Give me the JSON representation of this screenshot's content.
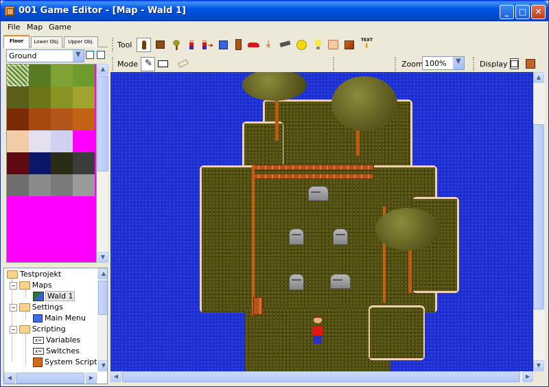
{
  "window": {
    "title": "001 Game Editor - [Map - Wald 1]"
  },
  "menu": [
    "File",
    "Map",
    "Game"
  ],
  "layer_tabs": [
    "Floor",
    "Lower Obj.",
    "Upper Obj."
  ],
  "tileset": {
    "selected": "Ground"
  },
  "tree": {
    "root": "Testprojekt",
    "items": [
      {
        "label": "Maps"
      },
      {
        "label": "Wald 1",
        "selected": true
      },
      {
        "label": "Settings"
      },
      {
        "label": "Main Menu"
      },
      {
        "label": "Scripting"
      },
      {
        "label": "Variables"
      },
      {
        "label": "Switches"
      },
      {
        "label": "System Scripts"
      }
    ]
  },
  "toolbar": {
    "tool_label": "Tool",
    "mode_label": "Mode",
    "zoom_label": "Zoom",
    "zoom_value": "100%",
    "display_label": "Display",
    "tools": [
      "brush-icon",
      "tile-icon",
      "tree-icon",
      "person-icon",
      "npc-icon",
      "block-icon",
      "door-icon",
      "car-icon",
      "download-icon",
      "cannon-icon",
      "coin-icon",
      "bulb-icon",
      "scroll-icon",
      "box-icon",
      "text-icon"
    ]
  },
  "map": {
    "name": "Wald 1",
    "graves_label": "RIP"
  }
}
